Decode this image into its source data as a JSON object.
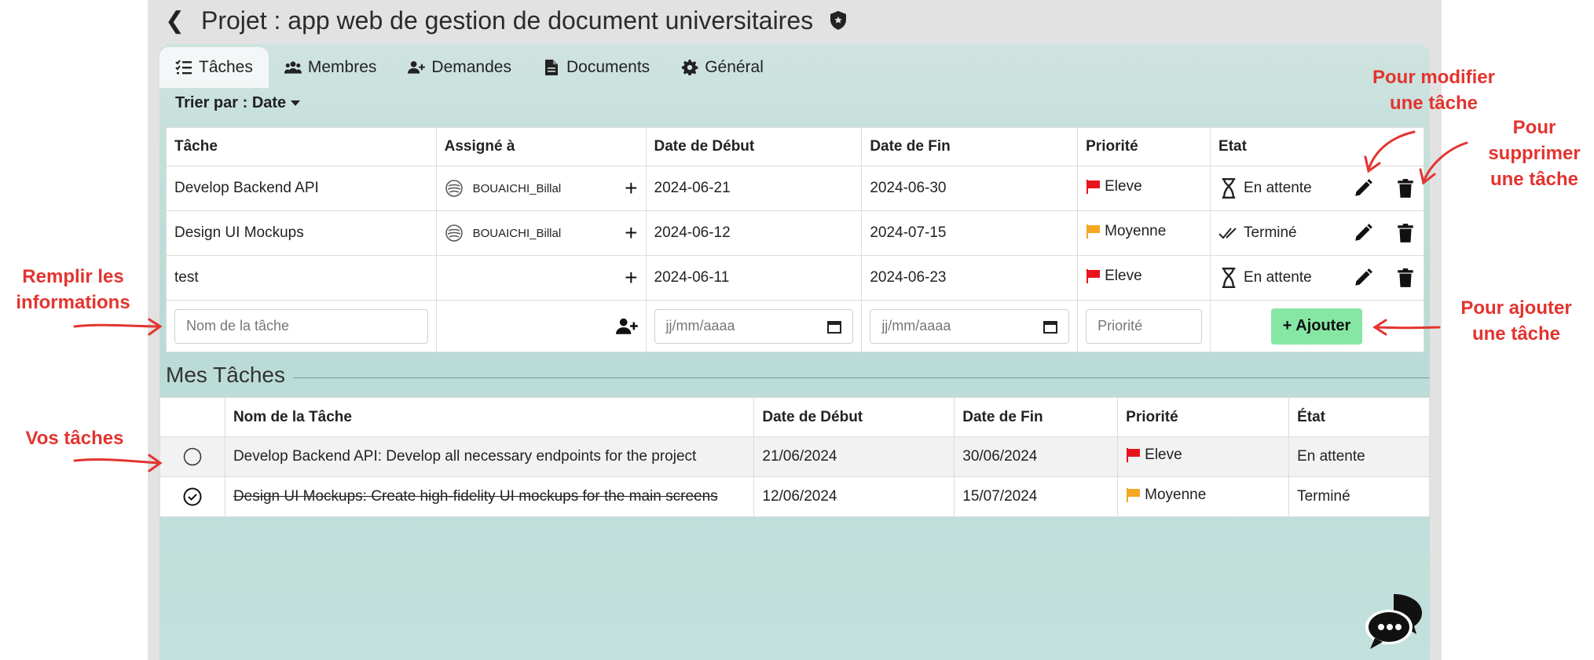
{
  "header": {
    "title": "Projet : app web de gestion de document universitaires"
  },
  "tabs": [
    {
      "label": "Tâches",
      "icon": "list-check-icon",
      "active": true
    },
    {
      "label": "Membres",
      "icon": "users-icon"
    },
    {
      "label": "Demandes",
      "icon": "user-plus-icon"
    },
    {
      "label": "Documents",
      "icon": "file-icon"
    },
    {
      "label": "Général",
      "icon": "gear-icon"
    }
  ],
  "sort": {
    "label": "Trier par : Date"
  },
  "task_table": {
    "columns": [
      "Tâche",
      "Assigné à",
      "Date de Début",
      "Date de Fin",
      "Priorité",
      "Etat"
    ],
    "rows": [
      {
        "task": "Develop Backend API",
        "assignee": "BOUAICHI_Billal",
        "start": "2024-06-21",
        "end": "2024-06-30",
        "priority": "Eleve",
        "state": "En attente"
      },
      {
        "task": "Design UI Mockups",
        "assignee": "BOUAICHI_Billal",
        "start": "2024-06-12",
        "end": "2024-07-15",
        "priority": "Moyenne",
        "state": "Terminé"
      },
      {
        "task": "test",
        "assignee": "",
        "start": "2024-06-11",
        "end": "2024-06-23",
        "priority": "Eleve",
        "state": "En attente"
      }
    ],
    "new_row": {
      "name_placeholder": "Nom de la tâche",
      "start_placeholder": "jj/mm/aaaa",
      "end_placeholder": "jj/mm/aaaa",
      "priority_placeholder": "Priorité",
      "add_label": "+ Ajouter"
    }
  },
  "my_tasks": {
    "title": "Mes Tâches",
    "columns": [
      "",
      "Nom de la Tâche",
      "Date de Début",
      "Date de Fin",
      "Priorité",
      "État"
    ],
    "rows": [
      {
        "name": "Develop Backend API: Develop all necessary endpoints for the project",
        "start": "21/06/2024",
        "end": "30/06/2024",
        "priority": "Eleve",
        "state": "En attente",
        "done": false
      },
      {
        "name": "Design UI Mockups: Create high-fidelity UI mockups for the main screens",
        "start": "12/06/2024",
        "end": "15/07/2024",
        "priority": "Moyenne",
        "state": "Terminé",
        "done": true
      }
    ]
  },
  "annotations": {
    "remplir": "Remplir les informations",
    "vos_taches": "Vos tâches",
    "modifier": "Pour modifier une tâche",
    "supprimer": "Pour supprimer une tâche",
    "ajouter": "Pour ajouter une tâche"
  },
  "colors": {
    "high": "#e8141b",
    "medium": "#f5a623",
    "add_button": "#86e7a4",
    "annotation": "#e3342f"
  }
}
